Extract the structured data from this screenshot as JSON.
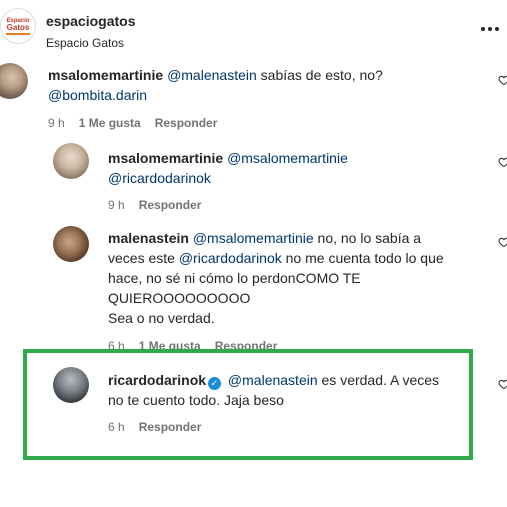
{
  "header": {
    "username": "espaciogatos",
    "subtitle": "Espacio Gatos",
    "logo_line1": "Espacio",
    "logo_line2": "Gatos"
  },
  "comments": [
    {
      "username": "msalomemartinie",
      "mention1": "@malenastein",
      "text1": "sabías de esto, no?",
      "mention2": "@bombita.darin",
      "time": "9 h",
      "likes": "1 Me gusta",
      "reply": "Responder"
    },
    {
      "username": "msalomemartinie",
      "mention1": "@msalomemartinie",
      "mention2": "@ricardodarinok",
      "time": "9 h",
      "reply": "Responder"
    },
    {
      "username": "malenastein",
      "mention1": "@msalomemartinie",
      "text1": "no, no lo sabía a",
      "text2": "veces este",
      "mention2": "@ricardodarinok",
      "text3": "no me cuenta todo lo que",
      "text4": "hace, no sé ni cómo lo perdonCOMO TE",
      "text5": "QUIEROOOOOOOOO",
      "text6": "Sea o no verdad.",
      "time": "6 h",
      "likes": "1 Me gusta",
      "reply": "Responder"
    },
    {
      "username": "ricardodarinok",
      "verified": "✓",
      "mention1": "@malenastein",
      "text1": "es verdad. A veces",
      "text2": "no te cuento todo. Jaja beso",
      "time": "6 h",
      "reply": "Responder"
    }
  ],
  "colors": {
    "highlight": "#2eaa4a",
    "mention": "#00376b",
    "meta": "#737373",
    "verified": "#1a8cd8"
  }
}
